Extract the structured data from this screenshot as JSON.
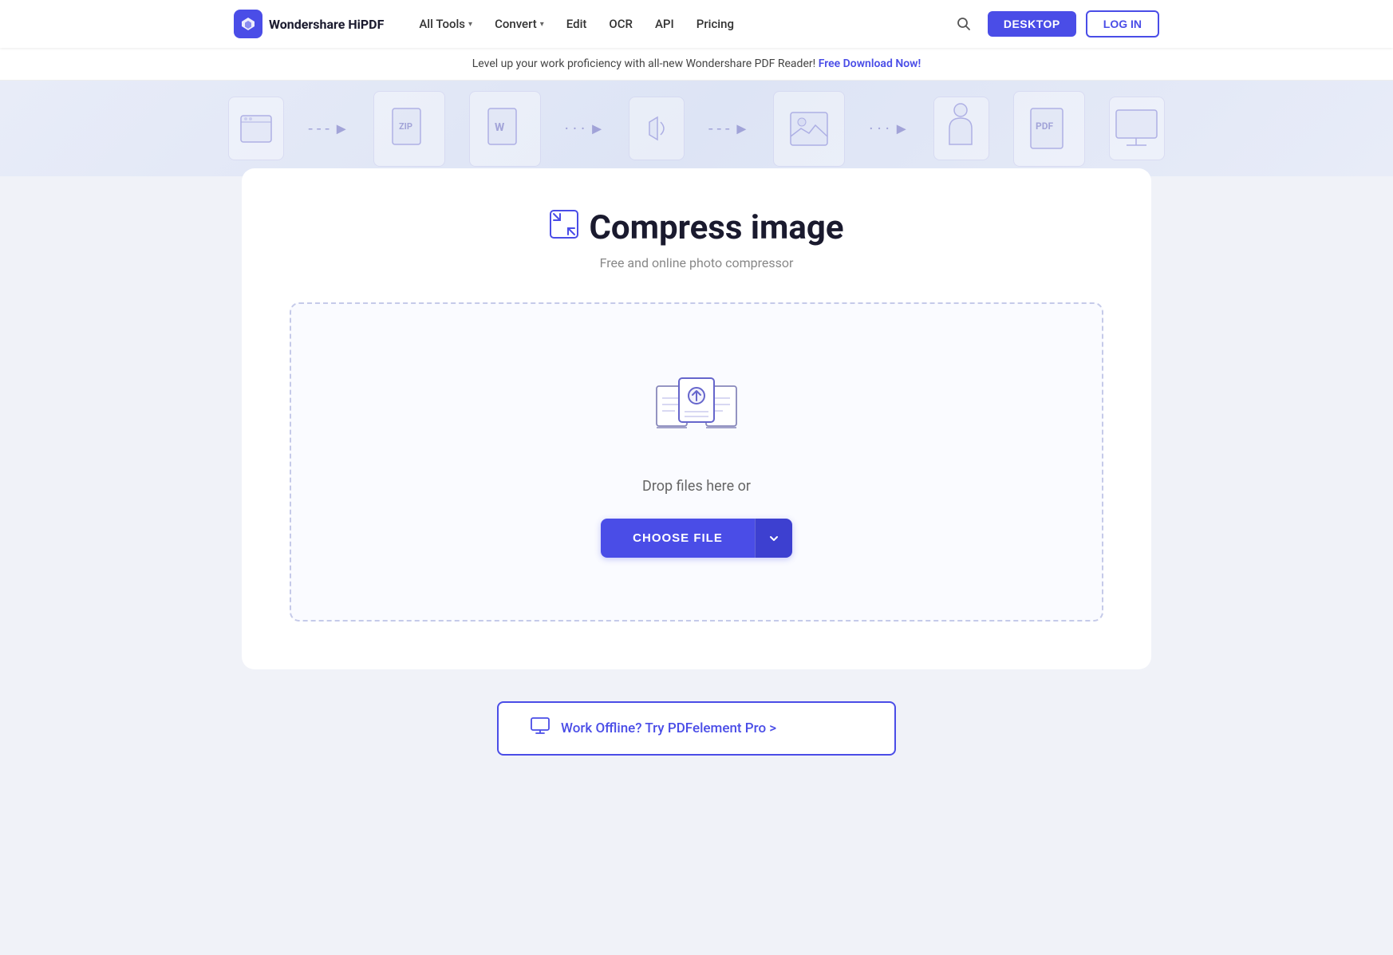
{
  "brand": {
    "name": "Wondershare HiPDF"
  },
  "navbar": {
    "all_tools_label": "All Tools",
    "convert_label": "Convert",
    "edit_label": "Edit",
    "ocr_label": "OCR",
    "api_label": "API",
    "pricing_label": "Pricing",
    "desktop_button": "DESKTOP",
    "login_button": "LOG IN"
  },
  "promo": {
    "text": "Level up your work proficiency with all-new Wondershare PDF Reader!",
    "link_text": "Free Download Now!"
  },
  "tool": {
    "title": "Compress image",
    "subtitle": "Free and online photo compressor",
    "drop_text": "Drop files here or",
    "choose_file_label": "CHOOSE FILE"
  },
  "offline": {
    "label": "Work Offline? Try PDFelement Pro >"
  },
  "icons": {
    "chevron_down": "▾",
    "compress": "⛶",
    "search": "🔍",
    "monitor": "🖥"
  }
}
